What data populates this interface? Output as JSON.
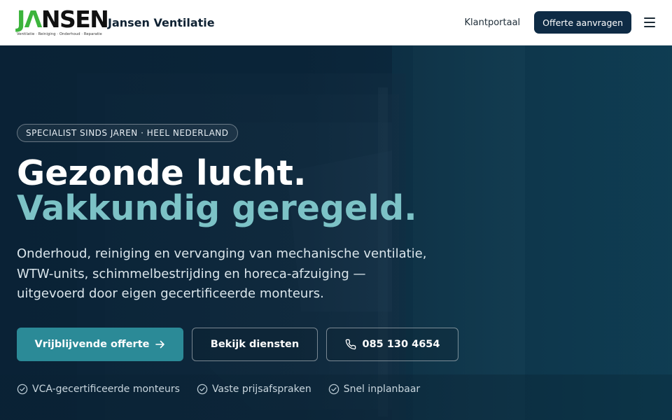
{
  "header": {
    "logo_letters": {
      "j": "J",
      "a": "Λ",
      "rest": "NSEN"
    },
    "logo_tagline": "Ventilatie · Reiniging · Onderhoud · Reparatie",
    "brand_name": "Jansen Ventilatie",
    "nav_link": "Klantportaal",
    "cta_label": "Offerte aanvragen",
    "menu_icon": "hamburger-icon"
  },
  "hero": {
    "badge": "SPECIALIST SINDS JAREN · HEEL NEDERLAND",
    "headline_line1": "Gezonde lucht.",
    "headline_line2": "Vakkundig geregeld.",
    "lead": "Onderhoud, reiniging en vervanging van mechanische ventilatie, WTW-units, schimmelbestrijding en horeca-afzuiging — uitgevoerd door eigen gecertificeerde monteurs.",
    "buttons": {
      "primary": "Vrijblijvende offerte",
      "services": "Bekijk diensten",
      "phone": "085 130 4654"
    },
    "checks": [
      "VCA-gecertificeerde monteurs",
      "Vaste prijsafspraken",
      "Snel inplanbaar"
    ]
  },
  "colors": {
    "header_bg": "#ffffff",
    "brand_green": "#3cb43c",
    "nav_cta_bg": "#0e2b45",
    "accent_teal": "#7cc2c6",
    "primary_button": "#2b8a97",
    "hero_bg": "#0d2a3f"
  }
}
